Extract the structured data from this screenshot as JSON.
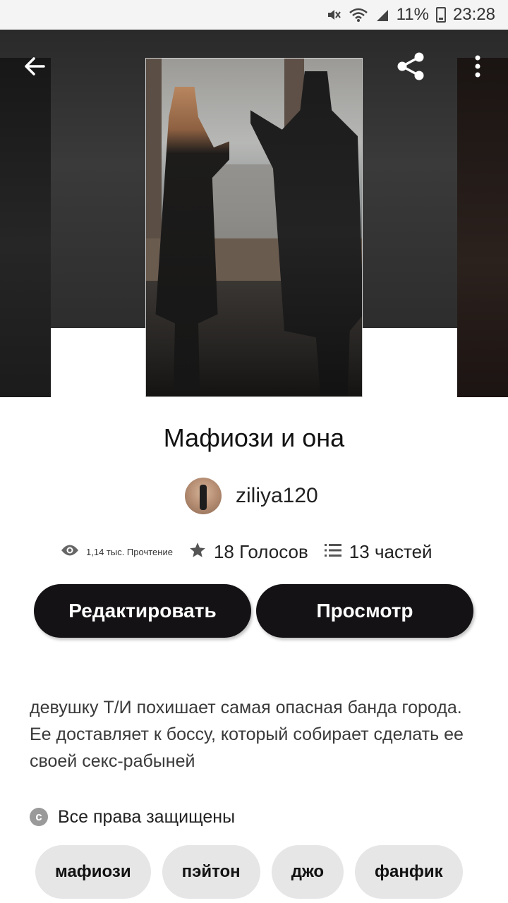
{
  "status_bar": {
    "battery": "11%",
    "time": "23:28",
    "icons": [
      "mute-icon",
      "wifi-icon",
      "signal-icon",
      "battery-icon"
    ]
  },
  "header": {
    "back_icon": "arrow-left-icon",
    "share_icon": "share-icon",
    "menu_icon": "more-vertical-icon"
  },
  "story": {
    "title": "Мафиози и она",
    "author": "ziliya120",
    "stats": {
      "reads": "1,14 тыс. Прочтение",
      "votes": "18 Голосов",
      "parts": "13 частей"
    },
    "description": "девушку Т/И похишает самая опасная банда города. Ее доставляет к боссу, который собирает сделать ее своей секс-рабыней",
    "rights": "Все права защищены"
  },
  "actions": {
    "edit_label": "Редактировать",
    "view_label": "Просмотр"
  },
  "tags": [
    "мафиози",
    "пэйтон",
    "джо",
    "фанфик"
  ],
  "colors": {
    "button_bg": "#141214",
    "tag_bg": "#e6e6e6",
    "text": "#121212"
  }
}
